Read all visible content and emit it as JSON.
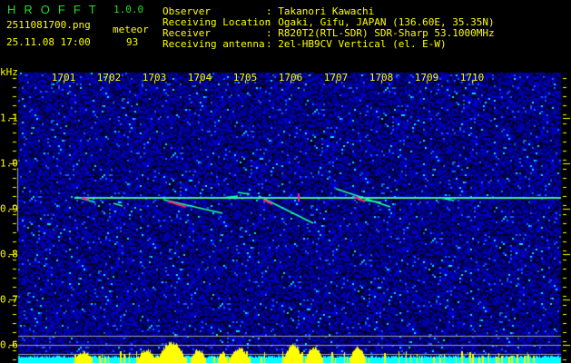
{
  "header": {
    "app_name": "HROFFT",
    "version": "1.0.0",
    "filename": "2511081700.png",
    "datetime": "25.11.08 17:00",
    "meteor_label": "meteor",
    "meteor_count": "93"
  },
  "info": [
    {
      "label": "Observer",
      "value": ": Takanori Kawachi"
    },
    {
      "label": "Receiving Location",
      "value": ": Ogaki, Gifu, JAPAN (136.60E, 35.35N)"
    },
    {
      "label": "Receiver",
      "value": ": R820T2(RTL-SDR) SDR-Sharp 53.1000MHz"
    },
    {
      "label": "Receiving antenna",
      "value": ": 2el-HB9CV Vertical (el. E-W)"
    }
  ],
  "spectrogram": {
    "unit_label": "kHz",
    "x_labels": [
      "1701",
      "1702",
      "1703",
      "1704",
      "1705",
      "1706",
      "1707",
      "1708",
      "1709",
      "1710"
    ],
    "y_labels": [
      "1.1",
      "1.0",
      "0.9",
      "0.8",
      "0.7",
      "0.6"
    ],
    "colors": {
      "noise": "#0000c8",
      "speckle": "#00e0ff",
      "trace_hot": "#ff2080",
      "trace": "#30ff60",
      "histogram": "#ffff00",
      "baseline": "#00ffff",
      "grid": "#a0a0a0"
    }
  }
}
